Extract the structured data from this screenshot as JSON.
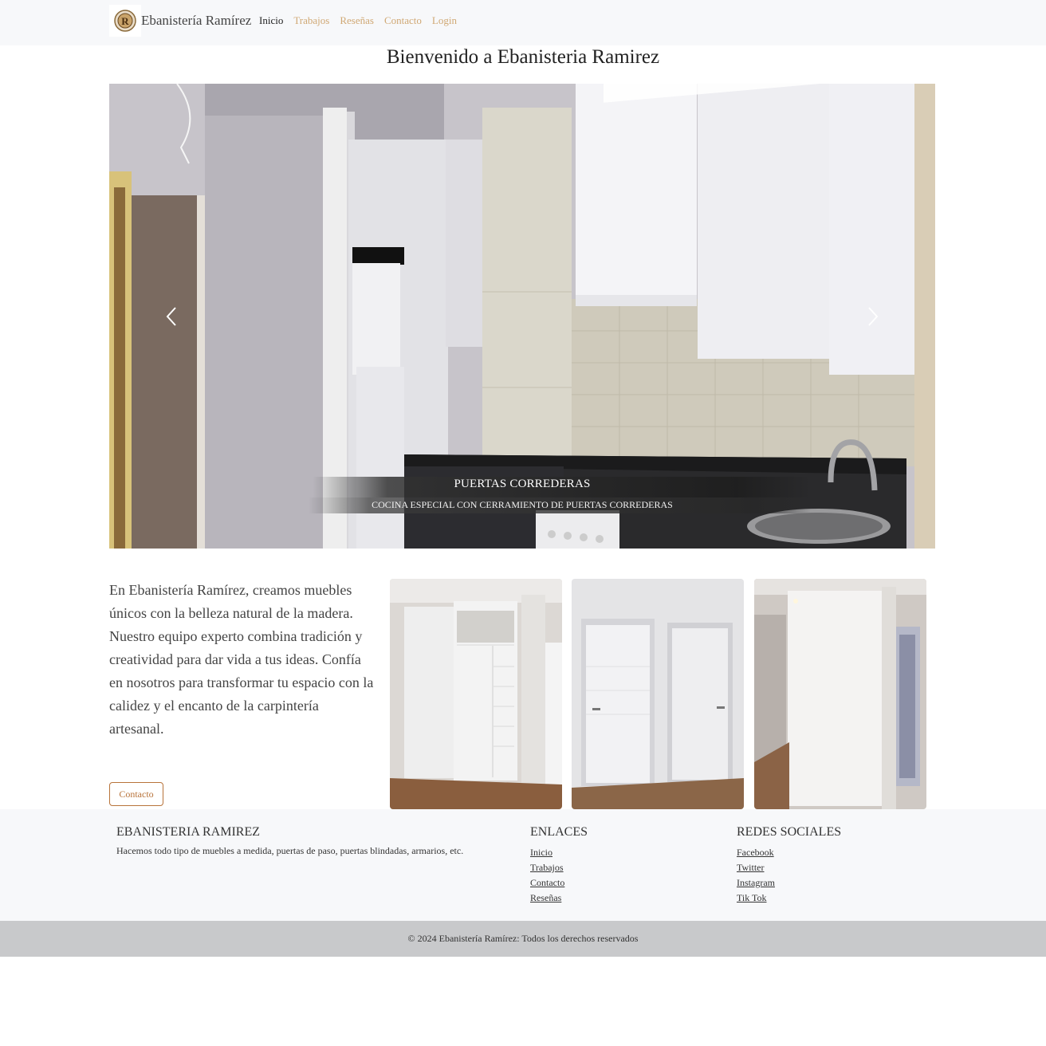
{
  "brand": {
    "name": "Ebanistería Ramírez",
    "logo_icon": "ornamental-r-logo"
  },
  "nav": {
    "items": [
      {
        "label": "Inicio",
        "active": true
      },
      {
        "label": "Trabajos",
        "active": false
      },
      {
        "label": "Reseñas",
        "active": false
      },
      {
        "label": "Contacto",
        "active": false
      },
      {
        "label": "Login",
        "active": false
      }
    ]
  },
  "hero": {
    "title": "Bienvenido a Ebanisteria Ramirez"
  },
  "carousel": {
    "caption_title": "PUERTAS CORREDERAS",
    "caption_subtitle": "COCINA ESPECIAL CON CERRAMIENTO DE PUERTAS CORREDERAS",
    "prev_icon": "chevron-left-icon",
    "next_icon": "chevron-right-icon"
  },
  "about": {
    "text": "En Ebanistería Ramírez, creamos muebles únicos con la belleza natural de la madera. Nuestro equipo experto combina tradición y creatividad para dar vida a tus ideas. Confía en nosotros para transformar tu espacio con la calidez y el encanto de la carpintería artesanal.",
    "button_label": "Contacto"
  },
  "footer": {
    "col1": {
      "title": "EBANISTERIA RAMIREZ",
      "text": "Hacemos todo tipo de muebles a medida, puertas de paso, puertas blindadas, armarios, etc."
    },
    "col2": {
      "title": "ENLACES",
      "links": [
        "Inicio",
        "Trabajos",
        "Contacto",
        "Reseñas"
      ]
    },
    "col3": {
      "title": "REDES SOCIALES",
      "links": [
        "Facebook",
        "Twitter",
        "Instagram",
        "Tik Tok"
      ]
    },
    "copyright": "© 2024 Ebanistería Ramírez: Todos los derechos reservados"
  },
  "colors": {
    "accent": "#b8733a",
    "nav_muted": "#d0a874",
    "footer_bg": "#f7f8fa",
    "copyright_bg": "#c8c9cb"
  }
}
